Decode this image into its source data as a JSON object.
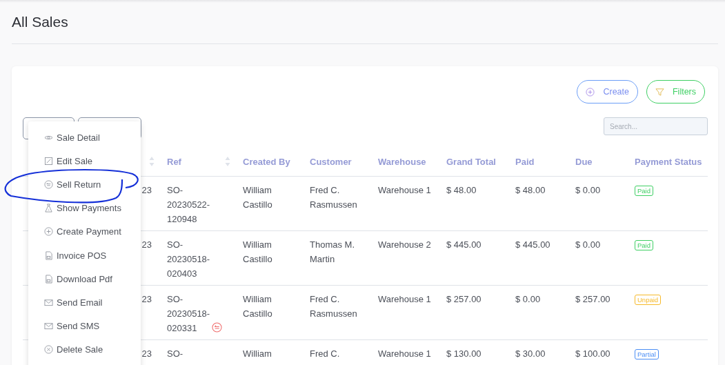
{
  "page": {
    "title": "All Sales"
  },
  "toolbar": {
    "create": "Create",
    "filters": "Filters",
    "search": {
      "placeholder": "Search..."
    }
  },
  "table": {
    "columns": [
      {
        "sortable": true
      },
      {
        "label": "Ref",
        "sortable": true
      },
      {
        "label": "Created By",
        "sortable": false
      },
      {
        "label": "Customer",
        "sortable": false
      },
      {
        "label": "Warehouse",
        "sortable": false
      },
      {
        "label": "Grand Total",
        "sortable": false
      },
      {
        "label": "Paid",
        "sortable": false
      },
      {
        "label": "Due",
        "sortable": false
      },
      {
        "label": "Payment Status",
        "sortable": false
      }
    ],
    "rows": [
      {
        "date": "23",
        "ref": "SO-20230522-120948",
        "returned": false,
        "created_by": "William Castillo",
        "customer": "Fred C. Rasmussen",
        "warehouse": "Warehouse 1",
        "grand_total": "$ 48.00",
        "paid": "$ 48.00",
        "due": "$ 0.00",
        "status": {
          "label": "Paid",
          "kind": "paid"
        }
      },
      {
        "date": "23",
        "ref": "SO-20230518-020403",
        "returned": false,
        "created_by": "William Castillo",
        "customer": "Thomas M. Martin",
        "warehouse": "Warehouse 2",
        "grand_total": "$ 445.00",
        "paid": "$ 445.00",
        "due": "$ 0.00",
        "status": {
          "label": "Paid",
          "kind": "paid"
        }
      },
      {
        "date": "23",
        "ref": "SO-20230518-020331",
        "returned": true,
        "created_by": "William Castillo",
        "customer": "Fred C. Rasmussen",
        "warehouse": "Warehouse 1",
        "grand_total": "$ 257.00",
        "paid": "$ 0.00",
        "due": "$ 257.00",
        "status": {
          "label": "Unpaid",
          "kind": "unpaid"
        }
      },
      {
        "date": "23",
        "ref": "SO-",
        "created_by": "William",
        "customer": "Fred C.",
        "warehouse": "Warehouse 1",
        "grand_total": "$ 130.00",
        "paid": "$ 30.00",
        "due": "$ 100.00",
        "status": {
          "label": "Partial",
          "kind": "partial"
        }
      }
    ]
  },
  "action_menu": {
    "items": [
      "Sale Detail",
      "Edit Sale",
      "Sell Return",
      "Show Payments",
      "Create Payment",
      "Invoice POS",
      "Download Pdf",
      "Send Email",
      "Send SMS",
      "Delete Sale"
    ]
  }
}
